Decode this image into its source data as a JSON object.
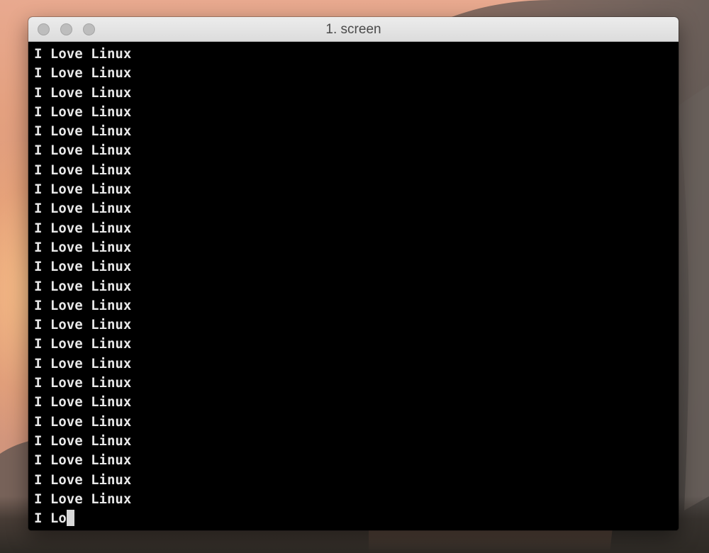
{
  "window": {
    "title": "1. screen",
    "controls": [
      {
        "name": "close-button",
        "color": "#bdbdbd"
      },
      {
        "name": "minimize-button",
        "color": "#bdbdbd"
      },
      {
        "name": "zoom-button",
        "color": "#bdbdbd"
      }
    ]
  },
  "terminal": {
    "lines": [
      "I Love Linux",
      "I Love Linux",
      "I Love Linux",
      "I Love Linux",
      "I Love Linux",
      "I Love Linux",
      "I Love Linux",
      "I Love Linux",
      "I Love Linux",
      "I Love Linux",
      "I Love Linux",
      "I Love Linux",
      "I Love Linux",
      "I Love Linux",
      "I Love Linux",
      "I Love Linux",
      "I Love Linux",
      "I Love Linux",
      "I Love Linux",
      "I Love Linux",
      "I Love Linux",
      "I Love Linux",
      "I Love Linux",
      "I Love Linux"
    ],
    "current_input": "I Lo",
    "background": "#000000",
    "foreground": "#e8e8e8"
  }
}
